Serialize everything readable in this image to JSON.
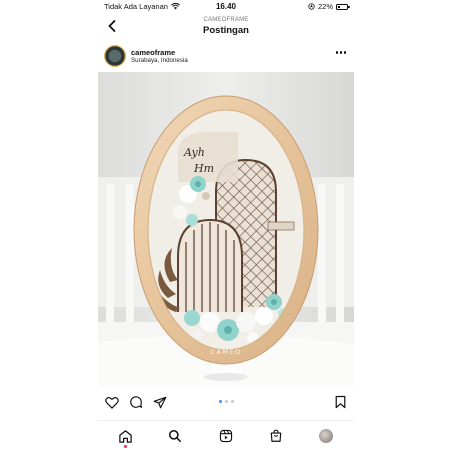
{
  "status_bar": {
    "carrier": "Tidak Ada Layanan",
    "time": "16.40",
    "battery_percent": "22%",
    "battery_level": 0.22,
    "icons": [
      "wifi-icon",
      "location-icon",
      "battery-icon"
    ]
  },
  "header": {
    "subtitle": "CAMEOFRAME",
    "title": "Postingan",
    "back_icon": "chevron-left-icon"
  },
  "post": {
    "username": "cameoframe",
    "location": "Surabaya, Indonesia",
    "more_icon": "more-horizontal-icon",
    "watermark": "CAMEO",
    "carousel": {
      "count": 3,
      "active_index": 0
    }
  },
  "actions": {
    "icons": [
      "heart-icon",
      "comment-icon",
      "share-icon",
      "bookmark-icon"
    ]
  },
  "bottom_nav": {
    "items": [
      "home-icon",
      "search-icon",
      "reels-icon",
      "shop-icon",
      "profile-avatar"
    ],
    "active": "home-icon"
  },
  "colors": {
    "accent_blue": "#3b92f0",
    "notification_red": "#e4315b",
    "frame_wood": "#e9cba4",
    "flowers_mint": "#8fd3cc"
  }
}
